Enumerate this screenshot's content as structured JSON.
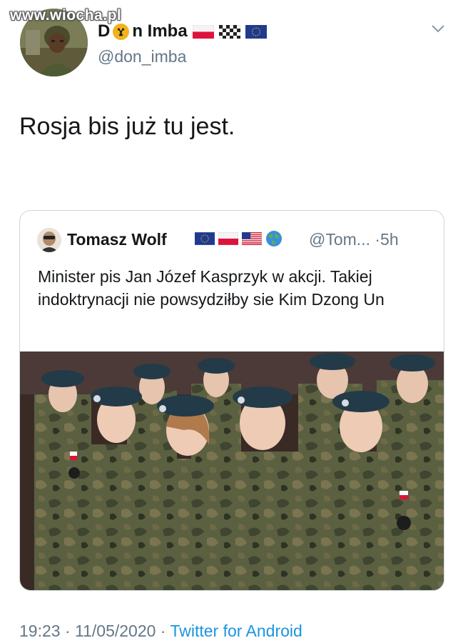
{
  "watermark": "www.wiocha.pl",
  "author": {
    "name_prefix": "D",
    "name_suffix": "n Imba",
    "handle": "@don_imba",
    "icons": [
      "radiation-icon",
      "poland-flag-icon",
      "checkered-flag-icon",
      "eu-flag-icon"
    ]
  },
  "tweet": {
    "text": "Rosja bis już tu jest."
  },
  "quoted": {
    "name": "Tomasz Wolf",
    "flags": [
      "eu-flag-icon",
      "poland-flag-icon",
      "usa-flag-icon",
      "globe-icon"
    ],
    "handle": "@Tom...",
    "separator": "·",
    "time": "5h",
    "text": "Minister pis Jan Józef Kasprzyk w akcji. Takiej indoktrynacji nie powsydziłby sie Kim Dzong Un",
    "image": "photo of children in camouflage uniforms and berets"
  },
  "footer": {
    "time": "19:23",
    "sep1": " · ",
    "date": "11/05/2020",
    "sep2": " · ",
    "source": "Twitter for Android"
  },
  "colors": {
    "text": "#14171a",
    "secondary": "#657786",
    "link": "#1b95e0",
    "border": "#ccd6dd"
  }
}
